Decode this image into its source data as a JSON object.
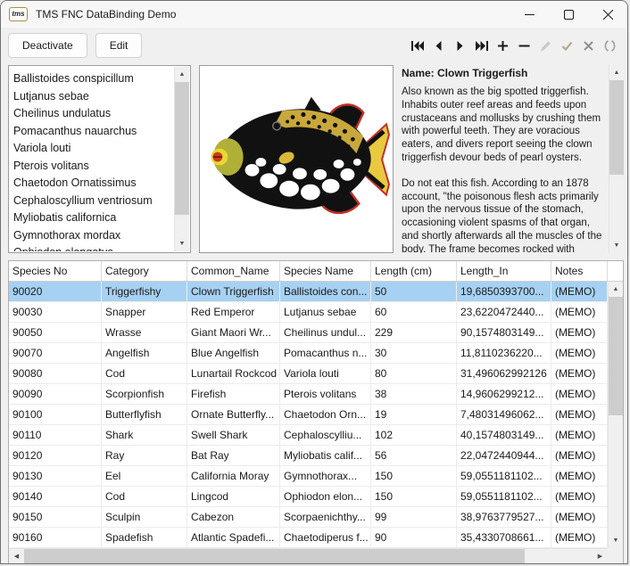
{
  "window": {
    "title": "TMS FNC DataBinding Demo",
    "icon_text": "tms"
  },
  "colors": {
    "selection": "#a7d1f2",
    "toolbar_icon_dark": "#1a1a1a",
    "toolbar_icon_gray": "#9f9f9f"
  },
  "toolbar": {
    "deactivate_label": "Deactivate",
    "edit_label": "Edit",
    "nav_icons": [
      "first",
      "prior",
      "next",
      "last",
      "insert",
      "delete",
      "edit",
      "post",
      "cancel",
      "refresh"
    ]
  },
  "species_list": {
    "items": [
      "Ballistoides conspicillum",
      "Lutjanus sebae",
      "Cheilinus undulatus",
      "Pomacanthus nauarchus",
      "Variola louti",
      "Pterois volitans",
      "Chaetodon Ornatissimus",
      "Cephaloscyllium ventriosum",
      "Myliobatis californica",
      "Gymnothorax mordax",
      "Ophiodon elongatus"
    ]
  },
  "detail": {
    "name_label": "Name: Clown Triggerfish",
    "paragraph1": "Also known as the big spotted triggerfish.  Inhabits outer reef areas and feeds upon crustaceans and mollusks by crushing them with powerful teeth.  They are voracious eaters, and divers report seeing the clown triggerfish devour beds of pearl oysters.",
    "paragraph2": "Do not eat this fish.  According to an 1878 account, \"the poisonous flesh acts primarily upon the nervous tissue of the stomach, occasioning violent spasms of that organ, and shortly afterwards all the muscles of the body.  The frame becomes rocked with spasms, the tongue thickened, the eye fixed, the breathing"
  },
  "grid": {
    "columns": [
      "Species No",
      "Category",
      "Common_Name",
      "Species Name",
      "Length (cm)",
      "Length_In",
      "Notes"
    ],
    "selected_index": 0,
    "rows": [
      [
        "90020",
        "Triggerfishy",
        "Clown Triggerfish",
        "Ballistoides con...",
        "50",
        "19,6850393700...",
        "(MEMO)"
      ],
      [
        "90030",
        "Snapper",
        "Red Emperor",
        "Lutjanus sebae",
        "60",
        "23,6220472440...",
        "(MEMO)"
      ],
      [
        "90050",
        "Wrasse",
        "Giant Maori Wr...",
        "Cheilinus undul...",
        "229",
        "90,1574803149...",
        "(MEMO)"
      ],
      [
        "90070",
        "Angelfish",
        "Blue Angelfish",
        "Pomacanthus n...",
        "30",
        "11,8110236220...",
        "(MEMO)"
      ],
      [
        "90080",
        "Cod",
        "Lunartail Rockcod",
        "Variola louti",
        "80",
        "31,496062992126",
        "(MEMO)"
      ],
      [
        "90090",
        "Scorpionfish",
        "Firefish",
        "Pterois volitans",
        "38",
        "14,9606299212...",
        "(MEMO)"
      ],
      [
        "90100",
        "Butterflyfish",
        "Ornate Butterfly...",
        "Chaetodon Orn...",
        "19",
        "7,48031496062...",
        "(MEMO)"
      ],
      [
        "90110",
        "Shark",
        "Swell Shark",
        "Cephaloscylliu...",
        "102",
        "40,1574803149...",
        "(MEMO)"
      ],
      [
        "90120",
        "Ray",
        "Bat Ray",
        "Myliobatis calif...",
        "56",
        "22,0472440944...",
        "(MEMO)"
      ],
      [
        "90130",
        "Eel",
        "California Moray",
        "Gymnothorax...",
        "150",
        "59,0551181102...",
        "(MEMO)"
      ],
      [
        "90140",
        "Cod",
        "Lingcod",
        "Ophiodon elon...",
        "150",
        "59,0551181102...",
        "(MEMO)"
      ],
      [
        "90150",
        "Sculpin",
        "Cabezon",
        "Scorpaenichthy...",
        "99",
        "38,9763779527...",
        "(MEMO)"
      ],
      [
        "90160",
        "Spadefish",
        "Atlantic Spadefi...",
        "Chaetodiperus f...",
        "90",
        "35,4330708661...",
        "(MEMO)"
      ]
    ]
  }
}
